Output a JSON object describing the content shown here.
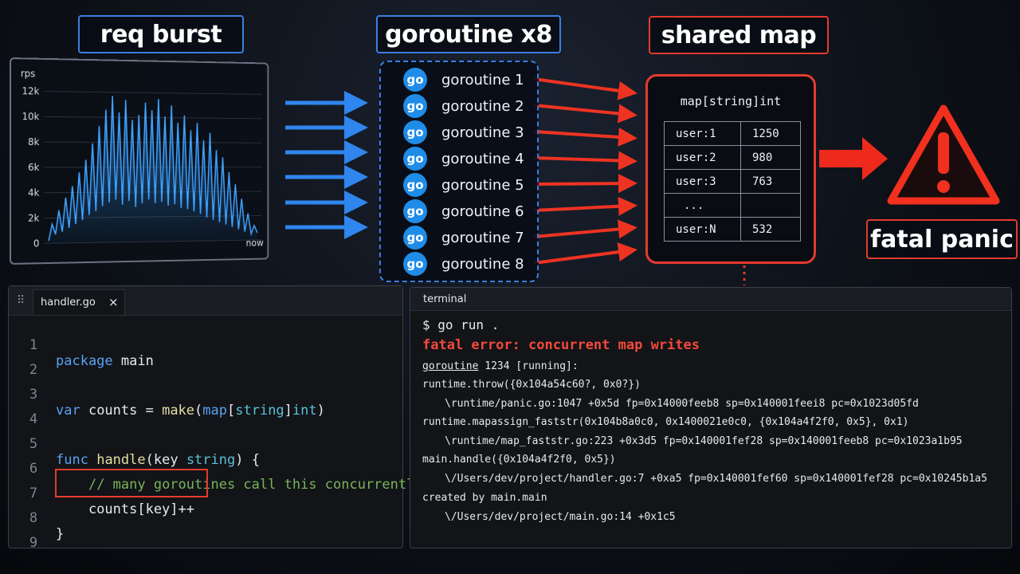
{
  "titles": {
    "burst": "req burst",
    "goroutines": "goroutine x8",
    "map": "shared map",
    "panic": "fatal panic"
  },
  "chart": {
    "y_unit": "rps",
    "y_ticks": [
      "0",
      "2k",
      "4k",
      "6k",
      "8k",
      "10k",
      "12k"
    ],
    "x_end_label": "now"
  },
  "chart_data": {
    "type": "line",
    "ylabel": "rps",
    "ylim": [
      0,
      12000
    ],
    "y_ticks": [
      0,
      2000,
      4000,
      6000,
      8000,
      10000,
      12000
    ],
    "values": [
      200,
      1500,
      700,
      2600,
      900,
      3600,
      1200,
      4500,
      1500,
      5600,
      1800,
      6600,
      2200,
      7900,
      2500,
      9300,
      2900,
      10600,
      3200,
      11700,
      3400,
      10400,
      3000,
      11400,
      3300,
      9800,
      2800,
      10200,
      3100,
      11200,
      3400,
      10600,
      3100,
      11500,
      3200,
      10100,
      2900,
      11000,
      3000,
      9600,
      2700,
      10200,
      2600,
      9000,
      2400,
      9600,
      2200,
      8200,
      1900,
      8800,
      1700,
      7400,
      1500,
      6800,
      1300,
      5600,
      1100,
      4600,
      900,
      3400,
      700,
      2200,
      500,
      1200,
      600
    ],
    "color": "#2f93f5"
  },
  "goroutines": [
    {
      "badge": "go",
      "label": "goroutine 1"
    },
    {
      "badge": "go",
      "label": "goroutine 2"
    },
    {
      "badge": "go",
      "label": "goroutine 3"
    },
    {
      "badge": "go",
      "label": "goroutine 4"
    },
    {
      "badge": "go",
      "label": "goroutine 5"
    },
    {
      "badge": "go",
      "label": "goroutine 6"
    },
    {
      "badge": "go",
      "label": "goroutine 7"
    },
    {
      "badge": "go",
      "label": "goroutine 8"
    }
  ],
  "map": {
    "type_label": "map[string]int",
    "rows": [
      {
        "key": "user:1",
        "value": "1250"
      },
      {
        "key": "user:2",
        "value": "980"
      },
      {
        "key": "user:3",
        "value": "763"
      },
      {
        "key": "...",
        "value": ""
      },
      {
        "key": "user:N",
        "value": "532"
      }
    ]
  },
  "editor": {
    "tab_label": "handler.go",
    "close_glyph": "×",
    "line_numbers": [
      "1",
      "2",
      "3",
      "4",
      "5",
      "6",
      "7",
      "8",
      "9"
    ],
    "code": {
      "l1_kw": "package",
      "l1_rest": " main",
      "l3_kw": "var",
      "l3_a": " counts = ",
      "l3_fn": "make",
      "l3_b": "(",
      "l3_map": "map",
      "l3_c": "[",
      "l3_str": "string",
      "l3_d": "]",
      "l3_int": "int",
      "l3_e": ")",
      "l5_kw": "func",
      "l5_sp": " ",
      "l5_fn": "handle",
      "l5_a": "(key ",
      "l5_ty": "string",
      "l5_b": ") {",
      "l6_indent": "    ",
      "l6_cm": "// many goroutines call this concurrently",
      "l7": "    counts[key]++",
      "l8": "}"
    }
  },
  "terminal": {
    "title": "terminal",
    "command": "$ go run .",
    "error": "fatal error: concurrent map writes",
    "goroutine_word": "goroutine",
    "goroutine_rest": " 1234 [running]:",
    "trace": [
      {
        "text": "runtime.throw({0x104a54c60?, 0x0?})",
        "indent": false
      },
      {
        "text": "\\runtime/panic.go:1047 +0x5d fp=0x14000feeb8 sp=0x140001feei8 pc=0x1023d05fd",
        "indent": true
      },
      {
        "text": "runtime.mapassign_faststr(0x104b8a0c0, 0x1400021e0c0, {0x104a4f2f0, 0x5}, 0x1)",
        "indent": false
      },
      {
        "text": "\\runtime/map_faststr.go:223 +0x3d5 fp=0x140001fef28 sp=0x140001feeb8 pc=0x1023a1b95",
        "indent": true
      },
      {
        "text": "main.handle({0x104a4f2f0, 0x5})",
        "indent": false
      },
      {
        "text": "\\/Users/dev/project/handler.go:7 +0xa5 fp=0x140001fef60 sp=0x140001fef28 pc=0x10245b1a5",
        "indent": true
      },
      {
        "text": "created by main.main",
        "indent": false
      },
      {
        "text": "\\/Users/dev/project/main.go:14 +0x1c5",
        "indent": true
      }
    ]
  },
  "colors": {
    "blue_accent": "#3b7fe0",
    "red_accent": "#e43a2e",
    "go_badge": "#1f8ce8",
    "error_text": "#f24a3a"
  }
}
